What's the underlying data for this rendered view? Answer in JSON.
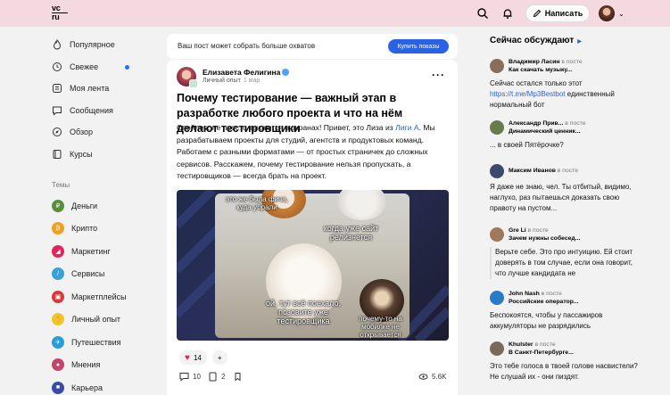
{
  "header": {
    "logo_top": "vc",
    "logo_bottom": "ru",
    "write_label": "Написать"
  },
  "sidebar": {
    "items": [
      {
        "label": "Популярное",
        "icon": "flame-icon"
      },
      {
        "label": "Свежее",
        "icon": "clock-icon"
      },
      {
        "label": "Моя лента",
        "icon": "feed-icon"
      },
      {
        "label": "Сообщения",
        "icon": "chat-icon"
      },
      {
        "label": "Обзор",
        "icon": "compass-icon"
      },
      {
        "label": "Курсы",
        "icon": "courses-icon"
      }
    ],
    "themes_title": "Темы",
    "themes": [
      {
        "label": "Деньги",
        "color": "#5a8f3a"
      },
      {
        "label": "Крипто",
        "color": "#f0a020"
      },
      {
        "label": "Маркетинг",
        "color": "#e0245e"
      },
      {
        "label": "Сервисы",
        "color": "#39a0d8"
      },
      {
        "label": "Маркетплейсы",
        "color": "#d83a3a"
      },
      {
        "label": "Личный опыт",
        "color": "#f2c230"
      },
      {
        "label": "Путешествия",
        "color": "#2a9dd8"
      },
      {
        "label": "Мнения",
        "color": "#c2456a"
      },
      {
        "label": "Карьера",
        "color": "#3a4aa8"
      }
    ]
  },
  "promo": {
    "text": "Ваш пост может собрать больше охватов",
    "button": "Купить показы"
  },
  "post": {
    "author": "Елизавета Фелигина",
    "category": "Личный опыт",
    "time": "1 мар",
    "title": "Почему тестирование — важный этап в разработке любого проекта и что на нём делают тестировщики",
    "body_before_link": "Спойлер: не просто тыкаются в экранах! Привет, это Лиза из ",
    "body_link": "Лиги А",
    "body_after_link": ". Мы разрабатываем проекты для студий, агентств и продуктовых команд. Работаем с разными форматами — от простых страничек до сложных сервисов. Расскажем, почему тестирование нельзя пропускать, а тестировщиков — всегда брать на проект.",
    "meme": {
      "top_left": "это же была фича, куда убрали",
      "top_right": "когда уже сайт релизнется",
      "bottom_left": "ой, тут всё поехало, позовите уже тестировщика",
      "bottom_right": "почему-то на мобилке не открывается"
    },
    "likes": "14",
    "add_reaction": "+",
    "comments": "10",
    "reposts": "2",
    "views": "5.6K"
  },
  "discussion": {
    "title": "Сейчас обсуждают",
    "comments": [
      {
        "author": "Владимир Ласин",
        "in": "в посте",
        "post": "Как скачать музыку...",
        "text_before": "Сейчас остался только этот ",
        "link": "https://t.me/Mp3Bestbot",
        "text_after": " единственный нормальный бот",
        "color": "#8a6e5a"
      },
      {
        "author": "Александр Прив...",
        "in": "в посте",
        "post": "Динамический ценник...",
        "text": "... в своей Пятёрочке?",
        "color": "#6b7a4a"
      },
      {
        "author": "Максим Иванов",
        "in": "в посте",
        "post": "",
        "text": "Я даже не знаю, чел. Ты отбитый, видимо, наглухо, раз пытаешься доказать свою правоту на пустом...",
        "color": "#3a4a6a"
      },
      {
        "author": "Gre Li",
        "in": "в посте",
        "post": "Зачем нужны собесед...",
        "text": "Верьте себе. Это про интуицию. Ей стоит доверять в том случае, если она говорит, что лучше кандидата не",
        "color": "#a0785a"
      },
      {
        "author": "John Nash",
        "in": "в посте",
        "post": "Российские оператор...",
        "text": "Беспокоятся, чтобы у пассажиров аккумуляторы не разрядились",
        "color": "#2a7ac8"
      },
      {
        "author": "Khulster",
        "in": "в посте",
        "post": "В Санкт-Петербурге...",
        "text": "Это тебе голоса в твоей голове насвистели? Не слушай их - они пиздят.",
        "color": "#7a6a5a"
      }
    ]
  }
}
